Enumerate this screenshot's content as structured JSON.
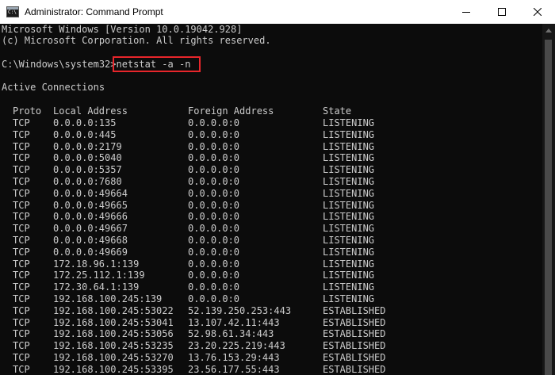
{
  "window": {
    "title": "Administrator: Command Prompt"
  },
  "console": {
    "banner_version": "Microsoft Windows [Version 10.0.19042.928]",
    "banner_copyright": "(c) Microsoft Corporation. All rights reserved.",
    "prompt": "C:\\Windows\\system32>",
    "command": "netstat -a -n",
    "section_title": "Active Connections",
    "headers": {
      "proto": "Proto",
      "local": "Local Address",
      "foreign": "Foreign Address",
      "state": "State"
    },
    "rows": [
      {
        "proto": "TCP",
        "local": "0.0.0.0:135",
        "foreign": "0.0.0.0:0",
        "state": "LISTENING"
      },
      {
        "proto": "TCP",
        "local": "0.0.0.0:445",
        "foreign": "0.0.0.0:0",
        "state": "LISTENING"
      },
      {
        "proto": "TCP",
        "local": "0.0.0.0:2179",
        "foreign": "0.0.0.0:0",
        "state": "LISTENING"
      },
      {
        "proto": "TCP",
        "local": "0.0.0.0:5040",
        "foreign": "0.0.0.0:0",
        "state": "LISTENING"
      },
      {
        "proto": "TCP",
        "local": "0.0.0.0:5357",
        "foreign": "0.0.0.0:0",
        "state": "LISTENING"
      },
      {
        "proto": "TCP",
        "local": "0.0.0.0:7680",
        "foreign": "0.0.0.0:0",
        "state": "LISTENING"
      },
      {
        "proto": "TCP",
        "local": "0.0.0.0:49664",
        "foreign": "0.0.0.0:0",
        "state": "LISTENING"
      },
      {
        "proto": "TCP",
        "local": "0.0.0.0:49665",
        "foreign": "0.0.0.0:0",
        "state": "LISTENING"
      },
      {
        "proto": "TCP",
        "local": "0.0.0.0:49666",
        "foreign": "0.0.0.0:0",
        "state": "LISTENING"
      },
      {
        "proto": "TCP",
        "local": "0.0.0.0:49667",
        "foreign": "0.0.0.0:0",
        "state": "LISTENING"
      },
      {
        "proto": "TCP",
        "local": "0.0.0.0:49668",
        "foreign": "0.0.0.0:0",
        "state": "LISTENING"
      },
      {
        "proto": "TCP",
        "local": "0.0.0.0:49669",
        "foreign": "0.0.0.0:0",
        "state": "LISTENING"
      },
      {
        "proto": "TCP",
        "local": "172.18.96.1:139",
        "foreign": "0.0.0.0:0",
        "state": "LISTENING"
      },
      {
        "proto": "TCP",
        "local": "172.25.112.1:139",
        "foreign": "0.0.0.0:0",
        "state": "LISTENING"
      },
      {
        "proto": "TCP",
        "local": "172.30.64.1:139",
        "foreign": "0.0.0.0:0",
        "state": "LISTENING"
      },
      {
        "proto": "TCP",
        "local": "192.168.100.245:139",
        "foreign": "0.0.0.0:0",
        "state": "LISTENING"
      },
      {
        "proto": "TCP",
        "local": "192.168.100.245:53022",
        "foreign": "52.139.250.253:443",
        "state": "ESTABLISHED"
      },
      {
        "proto": "TCP",
        "local": "192.168.100.245:53041",
        "foreign": "13.107.42.11:443",
        "state": "ESTABLISHED"
      },
      {
        "proto": "TCP",
        "local": "192.168.100.245:53056",
        "foreign": "52.98.61.34:443",
        "state": "ESTABLISHED"
      },
      {
        "proto": "TCP",
        "local": "192.168.100.245:53235",
        "foreign": "23.20.225.219:443",
        "state": "ESTABLISHED"
      },
      {
        "proto": "TCP",
        "local": "192.168.100.245:53270",
        "foreign": "13.76.153.29:443",
        "state": "ESTABLISHED"
      },
      {
        "proto": "TCP",
        "local": "192.168.100.245:53395",
        "foreign": "23.56.177.55:443",
        "state": "ESTABLISHED"
      }
    ]
  },
  "icons": {
    "app": "cmd-app-icon",
    "minimize": "minimize-icon",
    "maximize": "maximize-icon",
    "close": "close-icon",
    "scroll_up": "scroll-up-arrow-icon"
  },
  "colors": {
    "console_bg": "#0c0c0c",
    "console_text": "#cccccc",
    "highlight_border": "#e8262b",
    "titlebar_bg": "#ffffff"
  }
}
